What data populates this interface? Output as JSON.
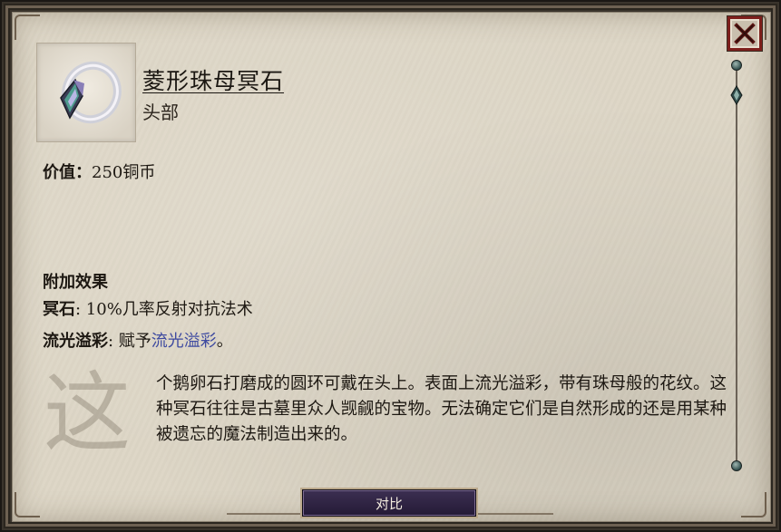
{
  "window": {
    "close_label": "X",
    "close_border_color": "#7d1f1c"
  },
  "item": {
    "name": "菱形珠母冥石",
    "slot": "头部",
    "icon": "ioun-stone-ring-icon",
    "value_label": "价值：",
    "value_text": "250铜币"
  },
  "effects": {
    "title": "附加效果",
    "list": [
      {
        "name": "冥石",
        "sep": ": ",
        "text": "10%几率反射对抗法术",
        "link": "",
        "tail": ""
      },
      {
        "name": "流光溢彩",
        "sep": ": ",
        "text": "赋予",
        "link": "流光溢彩",
        "tail": "。"
      }
    ],
    "link_color": "#3e4aa0"
  },
  "description": {
    "dropcap": "这",
    "text": "个鹅卵石打磨成的圆环可戴在头上。表面上流光溢彩，带有珠母般的花纹。这种冥石往往是古墓里众人觊觎的宝物。无法确定它们是自然形成的还是用某种被遗忘的魔法制造出来的。"
  },
  "footer": {
    "compare_label": "对比"
  },
  "scrollbar": {
    "position": 0
  }
}
